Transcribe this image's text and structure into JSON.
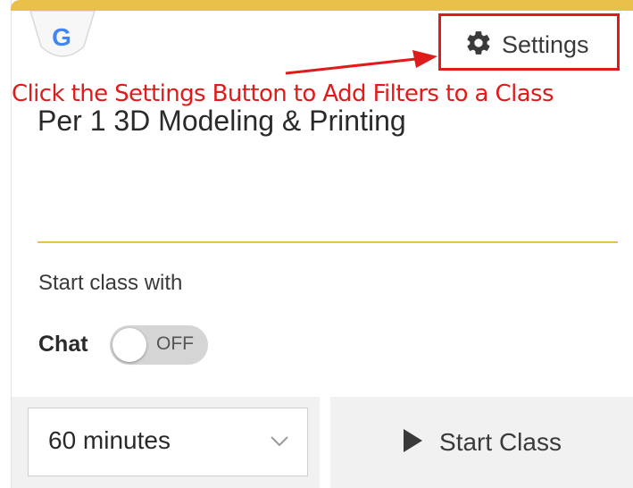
{
  "header": {
    "logo": "google-shield-logo",
    "logo_letter": "G",
    "settings_label": "Settings",
    "settings_icon": "gear-icon",
    "accent_color": "#e8c04a"
  },
  "annotation": {
    "text": "Click the Settings Button to Add Filters to a Class",
    "color": "#e01b1b"
  },
  "class": {
    "title": "Per 1 3D Modeling & Printing"
  },
  "options": {
    "start_with_label": "Start class with",
    "chat_label": "Chat",
    "chat_toggle_state": "OFF"
  },
  "footer": {
    "duration_value": "60 minutes",
    "start_label": "Start Class",
    "start_icon": "play-icon"
  }
}
